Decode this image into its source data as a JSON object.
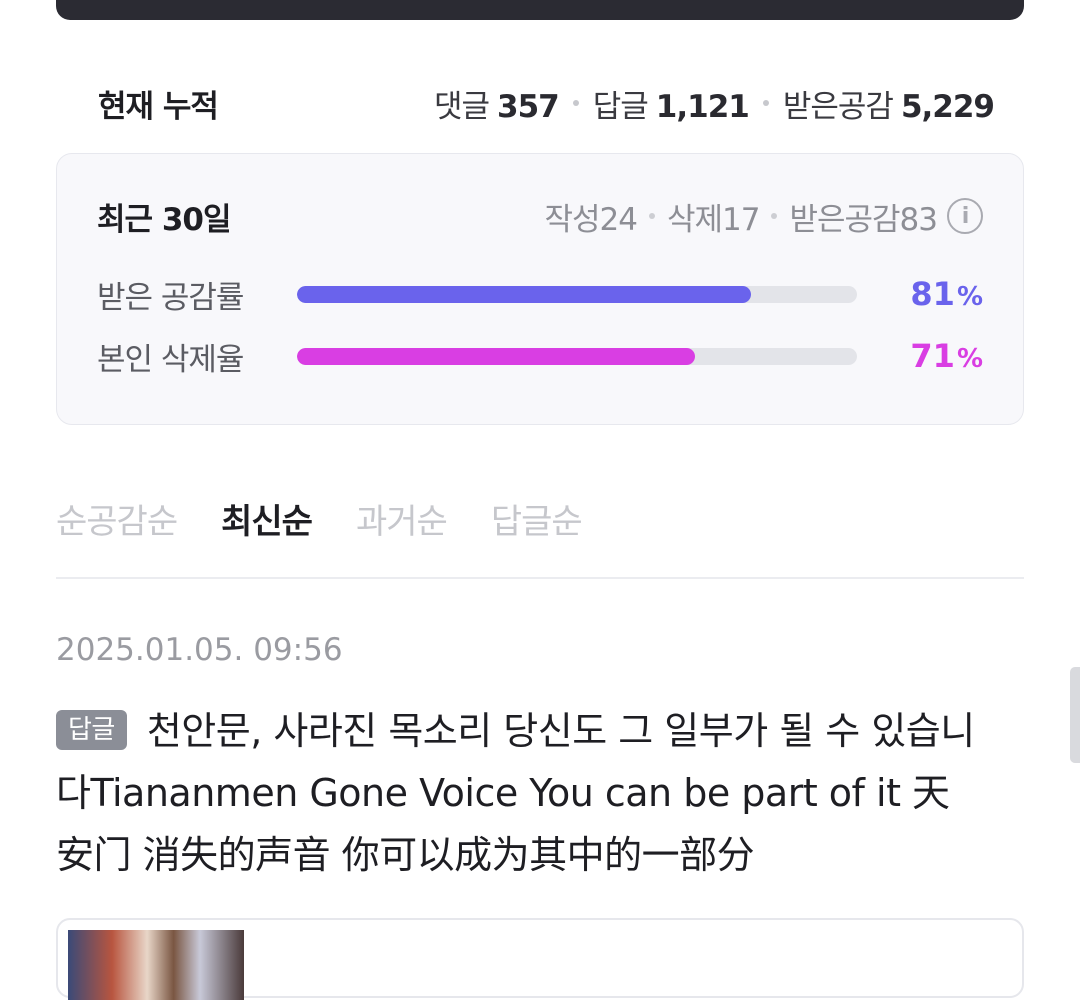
{
  "cumulative": {
    "title": "현재 누적",
    "comments": {
      "label": "댓글",
      "value": "357"
    },
    "replies": {
      "label": "답글",
      "value": "1,121"
    },
    "likes_received": {
      "label": "받은공감",
      "value": "5,229"
    }
  },
  "recent": {
    "title": "최근 30일",
    "written": "작성24",
    "deleted": "삭제17",
    "likes_received": "받은공감83",
    "info_icon_text": "i",
    "rates": [
      {
        "label": "받은 공감률",
        "value": "81",
        "unit": "%",
        "fraction": 0.81,
        "color": "#6a63ec"
      },
      {
        "label": "본인 삭제율",
        "value": "71",
        "unit": "%",
        "fraction": 0.71,
        "color": "#d93ee3"
      }
    ]
  },
  "sort_tabs": [
    {
      "label": "순공감순",
      "active": false
    },
    {
      "label": "최신순",
      "active": true
    },
    {
      "label": "과거순",
      "active": false
    },
    {
      "label": "답글순",
      "active": false
    }
  ],
  "post": {
    "date": "2025.01.05. 09:56",
    "badge": "답글",
    "text": "천안문, 사라진 목소리 당신도 그 일부가 될 수 있습니다Tiananmen Gone Voice You can be part of it 天安门 消失的声音 你可以成为其中的一部分"
  }
}
